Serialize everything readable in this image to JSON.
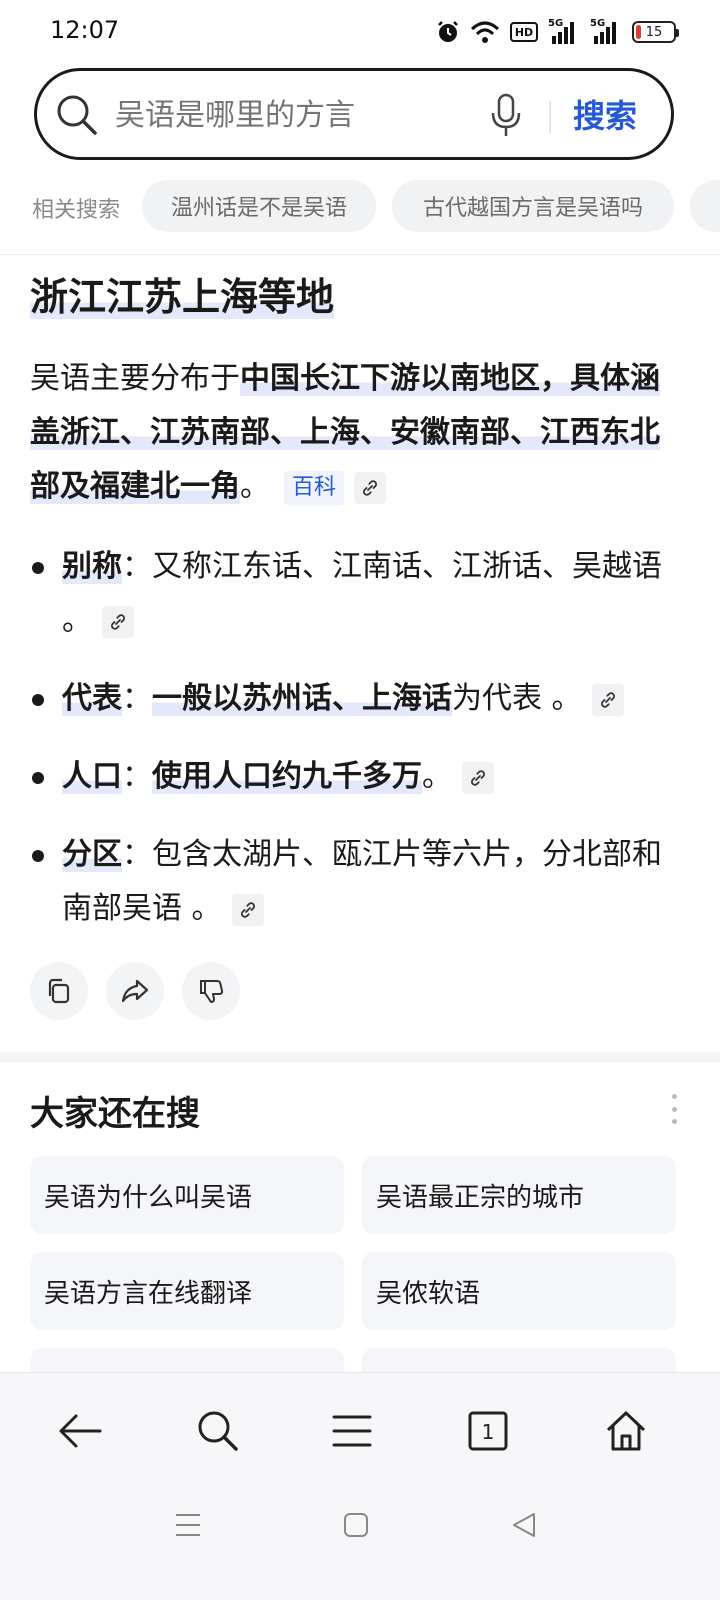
{
  "status_bar": {
    "time": "12:07",
    "hd_label": "HD",
    "sim1_label": "5G",
    "sim2_label": "5G",
    "battery_level": "15",
    "battery_color": "#e53935"
  },
  "search": {
    "placeholder": "吴语是哪里的方言",
    "button_label": "搜索",
    "icon": "search-icon",
    "voice_icon": "microphone-icon"
  },
  "related": {
    "label": "相关搜索",
    "chips": [
      "温州话是不是吴语",
      "古代越国方言是吴语吗"
    ]
  },
  "answer": {
    "heading": "浙江江苏上海等地",
    "intro_prefix": "吴语主要分布于",
    "intro_bold": "中国长江下游以南地区，具体涵盖浙江、江苏南部、上海、安徽南部、江西东北部及福建北一角",
    "intro_suffix": "。",
    "source_tag": "百科",
    "bullets": [
      {
        "label": "别称",
        "sep": "：",
        "text": "又称江东话、江南话、江浙话、吴越语 。"
      },
      {
        "label": "代表",
        "sep": "：",
        "bold": "一般以苏州话、上海话",
        "text": "为代表 。"
      },
      {
        "label": "人口",
        "sep": "：",
        "bold": "使用人口约九千多万",
        "text": "。"
      },
      {
        "label": "分区",
        "sep": "：",
        "text": "包含太湖片、瓯江片等六片，分北部和南部吴语 。"
      }
    ]
  },
  "actions": [
    "copy-icon",
    "share-icon",
    "dislike-icon"
  ],
  "others": {
    "title": "大家还在搜",
    "items": [
      "吴语为什么叫吴语",
      "吴语最正宗的城市",
      "吴语方言在线翻译",
      "吴侬软语"
    ]
  },
  "bottom_nav": {
    "tab_count": "1",
    "icons": [
      "back-arrow-icon",
      "search-icon",
      "menu-icon",
      "tabs-icon",
      "home-icon"
    ]
  },
  "colors": {
    "accent": "#2458d6",
    "highlight": "#e4e8fb"
  }
}
